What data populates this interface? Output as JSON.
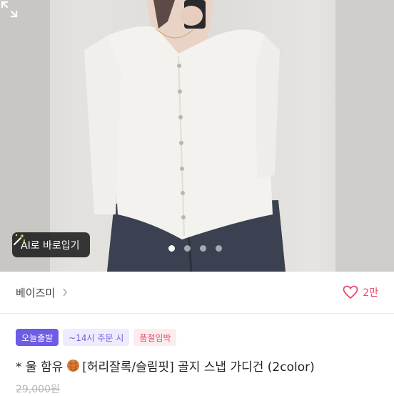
{
  "photo": {
    "ai_button_label": "AI로 바로입기",
    "ai_button_icon": "magic-wand-icon",
    "page_count": 4,
    "active_page": 1,
    "expand_icon": "expand-icon"
  },
  "shop": {
    "name": "베이즈미",
    "arrow_icon": "chevron-right-icon",
    "like_icon": "heart-outline-icon",
    "like_count": "2만"
  },
  "badges": {
    "today": "오늘출발",
    "time": "~14시 주문 시",
    "stock": "품절임박"
  },
  "product": {
    "title_prefix": "* 울 함유",
    "title_icon": "yarn-ball-icon",
    "title_rest": "[허리잘록/슬림핏] 골지 스냅 가디건 (2color)",
    "original_price": "29,000원"
  },
  "colors": {
    "accent_purple": "#6e5ce6",
    "like_pink": "#e64b6a",
    "stock_red": "#e5506b"
  }
}
